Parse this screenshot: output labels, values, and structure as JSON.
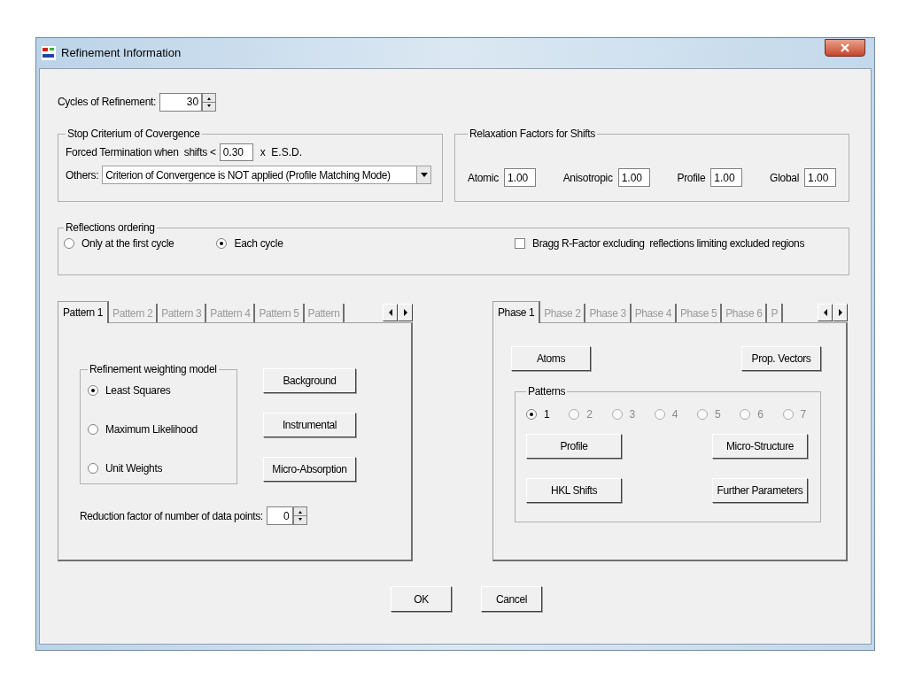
{
  "window": {
    "title": "Refinement Information"
  },
  "cycles": {
    "label": "Cycles of Refinement:",
    "value": "30"
  },
  "stop_criterium": {
    "title": "Stop Criterium of Covergence",
    "forced_label": "Forced Termination when  shifts <",
    "forced_value": "0.30",
    "forced_suffix": "x  E.S.D.",
    "others_label": "Others:",
    "others_value": "Criterion of Convergence is NOT applied (Profile Matching Mode)"
  },
  "relaxation": {
    "title": "Relaxation Factors for Shifts",
    "fields": [
      {
        "label": "Atomic",
        "value": "1.00"
      },
      {
        "label": "Anisotropic",
        "value": "1.00"
      },
      {
        "label": "Profile",
        "value": "1.00"
      },
      {
        "label": "Global",
        "value": "1.00"
      }
    ]
  },
  "reflections": {
    "title": "Reflections ordering",
    "options": [
      {
        "label": "Only at the first cycle",
        "selected": false
      },
      {
        "label": "Each cycle",
        "selected": true
      }
    ],
    "checkbox": {
      "label": "Bragg R-Factor excluding  reflections limiting excluded regions",
      "checked": false
    }
  },
  "pattern_tabs": {
    "tabs": [
      {
        "label": "Pattern 1",
        "selected": true,
        "disabled": false
      },
      {
        "label": "Pattern 2",
        "selected": false,
        "disabled": true
      },
      {
        "label": "Pattern 3",
        "selected": false,
        "disabled": true
      },
      {
        "label": "Pattern 4",
        "selected": false,
        "disabled": true
      },
      {
        "label": "Pattern 5",
        "selected": false,
        "disabled": true
      },
      {
        "label": "Pattern",
        "selected": false,
        "disabled": true
      }
    ],
    "weighting": {
      "title": "Refinement weighting model",
      "options": [
        {
          "label": "Least Squares",
          "selected": true
        },
        {
          "label": "Maximum Likelihood",
          "selected": false
        },
        {
          "label": "Unit Weights",
          "selected": false
        }
      ]
    },
    "buttons": [
      "Background",
      "Instrumental",
      "Micro-Absorption"
    ],
    "reduction": {
      "label": "Reduction factor of number of data points:",
      "value": "0"
    }
  },
  "phase_tabs": {
    "tabs": [
      {
        "label": "Phase 1",
        "selected": true,
        "disabled": false
      },
      {
        "label": "Phase 2",
        "selected": false,
        "disabled": true
      },
      {
        "label": "Phase 3",
        "selected": false,
        "disabled": true
      },
      {
        "label": "Phase 4",
        "selected": false,
        "disabled": true
      },
      {
        "label": "Phase 5",
        "selected": false,
        "disabled": true
      },
      {
        "label": "Phase 6",
        "selected": false,
        "disabled": true
      },
      {
        "label": "P",
        "selected": false,
        "disabled": true
      }
    ],
    "top_buttons": [
      "Atoms",
      "Prop. Vectors"
    ],
    "patterns": {
      "title": "Patterns",
      "options": [
        {
          "label": "1",
          "selected": true,
          "disabled": false
        },
        {
          "label": "2",
          "selected": false,
          "disabled": true
        },
        {
          "label": "3",
          "selected": false,
          "disabled": true
        },
        {
          "label": "4",
          "selected": false,
          "disabled": true
        },
        {
          "label": "5",
          "selected": false,
          "disabled": true
        },
        {
          "label": "6",
          "selected": false,
          "disabled": true
        },
        {
          "label": "7",
          "selected": false,
          "disabled": true
        }
      ]
    },
    "buttons": [
      "Profile",
      "Micro-Structure",
      "HKL Shifts",
      "Further Parameters"
    ]
  },
  "dialog_buttons": [
    "OK",
    "Cancel"
  ]
}
